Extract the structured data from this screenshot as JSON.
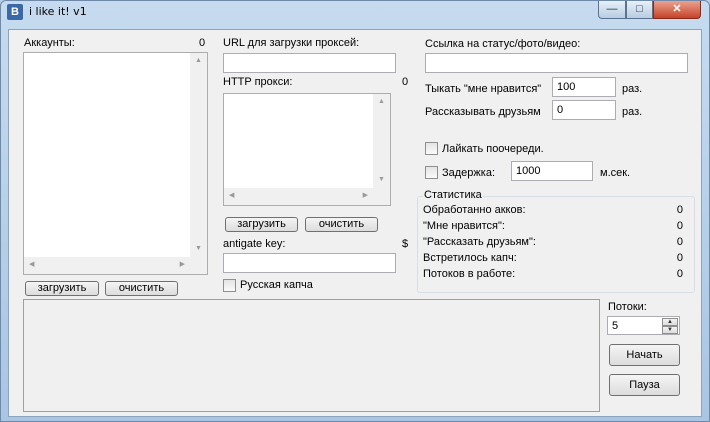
{
  "window": {
    "title": "i like it! v1",
    "icon_letter": "B",
    "min_glyph": "—",
    "max_glyph": "□",
    "close_glyph": "✕"
  },
  "accounts": {
    "label": "Аккаунты:",
    "count": "0",
    "load_button": "загрузить",
    "clear_button": "очистить"
  },
  "proxy": {
    "url_label": "URL для загрузки проксей:",
    "url_value": "",
    "http_label": "HTTP прокси:",
    "http_count": "0",
    "load_button": "загрузить",
    "clear_button": "очистить"
  },
  "antigate": {
    "label": "antigate key:",
    "currency": "$",
    "value": ""
  },
  "russian_captcha": {
    "label": "Русская капча",
    "checked": false
  },
  "link": {
    "label": "Ссылка на статус/фото/видео:",
    "value": ""
  },
  "like": {
    "label": "Тыкать \"мне нравится\"",
    "value": "100",
    "unit": "раз."
  },
  "share": {
    "label": "Рассказывать друзьям",
    "value": "0",
    "unit": "раз."
  },
  "like_queue": {
    "label": "Лайкать поочереди.",
    "checked": false
  },
  "delay": {
    "label": "Задержка:",
    "value": "1000",
    "unit": "м.сек.",
    "checked": false
  },
  "stats": {
    "title": "Статистика",
    "rows": [
      {
        "label": "Обработанно акков:",
        "value": "0"
      },
      {
        "label": "\"Мне нравится\":",
        "value": "0"
      },
      {
        "label": "\"Рассказать друзьям\":",
        "value": "0"
      },
      {
        "label": "Встретилось капч:",
        "value": "0"
      },
      {
        "label": "Потоков в работе:",
        "value": "0"
      }
    ]
  },
  "threads": {
    "label": "Потоки:",
    "value": "5"
  },
  "controls": {
    "start": "Начать",
    "pause": "Пауза"
  }
}
